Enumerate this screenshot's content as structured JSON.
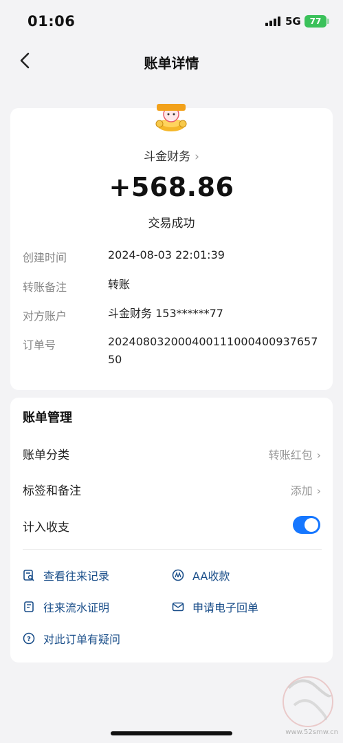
{
  "status_bar": {
    "time": "01:06",
    "network": "5G",
    "battery": "77"
  },
  "nav": {
    "title": "账单详情"
  },
  "summary": {
    "merchant": "斗金财务",
    "amount": "+568.86",
    "status": "交易成功"
  },
  "details": [
    {
      "label": "创建时间",
      "value": "2024-08-03 22:01:39"
    },
    {
      "label": "转账备注",
      "value": "转账"
    },
    {
      "label": "对方账户",
      "value": "斗金财务 153******77"
    },
    {
      "label": "订单号",
      "value": "20240803200040011100040093765750"
    }
  ],
  "management": {
    "title": "账单管理",
    "category_label": "账单分类",
    "category_value": "转账红包",
    "tags_label": "标签和备注",
    "tags_value": "添加",
    "count_label": "计入收支",
    "count_enabled": true
  },
  "actions": {
    "history": "查看往来记录",
    "aa": "AA收款",
    "statement": "往来流水证明",
    "receipt": "申请电子回单",
    "question": "对此订单有疑问"
  },
  "watermark": {
    "site": "www.52smw.cn"
  },
  "colors": {
    "accent": "#1677ff",
    "action_text": "#1b4f8a",
    "battery": "#3ac15a",
    "background": "#f3f3f5"
  }
}
